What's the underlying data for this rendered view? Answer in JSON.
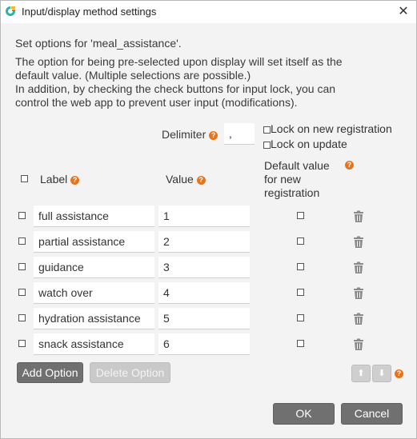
{
  "window": {
    "title": "Input/display method settings",
    "close_glyph": "✕"
  },
  "intro": {
    "line1": "Set options for 'meal_assistance'.",
    "line2": "The option for being pre-selected upon display will set itself as the",
    "line3": "default value. (Multiple selections are possible.)",
    "line4": "In addition, by checking the check buttons for input lock, you can",
    "line5": "control the web app to prevent user input (modifications)."
  },
  "delimiter": {
    "label": "Delimiter",
    "value": ","
  },
  "locks": {
    "new_registration": "Lock on new registration",
    "update": "Lock on update"
  },
  "headers": {
    "label": "Label",
    "value": "Value",
    "default_line1": "Default value",
    "default_line2": "for new",
    "default_line3": "registration"
  },
  "help_glyph": "?",
  "options": [
    {
      "label": "full assistance",
      "value": "1"
    },
    {
      "label": "partial assistance",
      "value": "2"
    },
    {
      "label": "guidance",
      "value": "3"
    },
    {
      "label": "watch over",
      "value": "4"
    },
    {
      "label": "hydration assistance",
      "value": "5"
    },
    {
      "label": "snack assistance",
      "value": "6"
    }
  ],
  "buttons": {
    "add_option": "Add Option",
    "delete_option": "Delete Option",
    "move_up": "⬆",
    "move_down": "⬇",
    "ok": "OK",
    "cancel": "Cancel"
  },
  "colors": {
    "help_orange": "#e8731b",
    "button_dark": "#707070",
    "button_disabled": "#c9c9c9"
  },
  "icons": {
    "app": "app-logo-icon",
    "close": "close-icon",
    "help": "help-icon",
    "delete": "trash-icon"
  }
}
